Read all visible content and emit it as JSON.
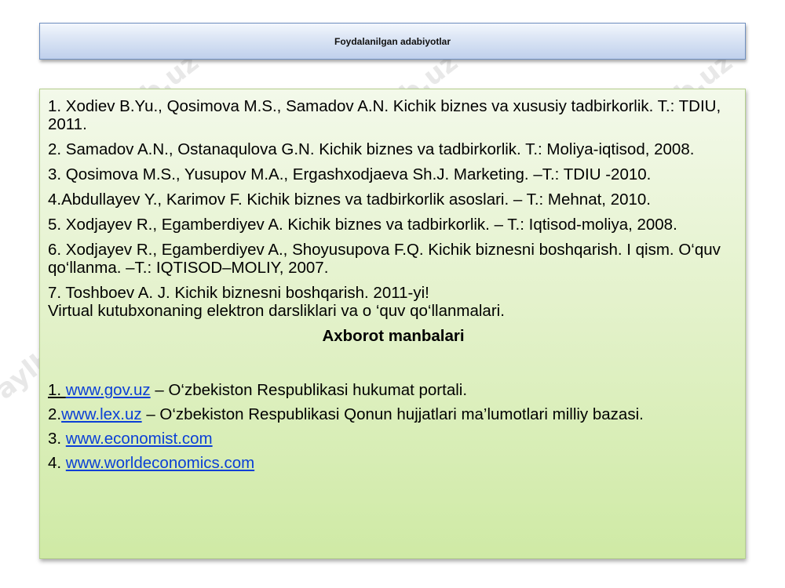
{
  "header": {
    "title": "Foydalanilgan adabiyotlar"
  },
  "references": [
    "1. Xodiev B.Yu., Qosimova M.S., Samadov A.N. Kichik biznes va xususiy tadbirkorlik. T.: TDIU, 2011.",
    "2. Samadov A.N., Ostanaqulova G.N. Kichik biznes va tadbirkorlik. T.: Moliya-iqtisod, 2008.",
    "3. Qosimova M.S., Yusupov M.A., Ergashxodjaeva Sh.J. Marketing. –T.: TDIU -2010.",
    "4.Abdullayev Y., Karimov F. Kichik biznes va tadbirkorlik asoslari. – T.: Mehnat, 2010.",
    "5. Xodjayev R., Egamberdiyev A. Kichik biznes va tadbirkorlik. – T.: Iqtisod-moliya, 2008.",
    "6. Xodjayev R., Egamberdiyev A., Shoyusupova F.Q. Kichik biznesni boshqarish. I qism. O‘quv qo‘llanma. –T.: IQTISOD–MOLIY, 2007.",
    "7. Toshboev A. J. Kichik biznesni boshqarish. 2011-yi!"
  ],
  "references_note": "Virtual kutubxonaning elektron darsliklari va o ‘quv qo‘llanmalari.",
  "sources": {
    "heading": "Axborot manbalari",
    "items": [
      {
        "num": "1. ",
        "link": "www.gov.uz",
        "desc": " – O‘zbekiston Respublikasi hukumat portali."
      },
      {
        "num": "2.",
        "link": "www.lex.uz",
        "desc": " – O‘zbekiston Respublikasi Qonun hujjatlari ma’lumotlari milliy bazasi."
      },
      {
        "num": "3. ",
        "link": "www.economist.com",
        "desc": ""
      },
      {
        "num": "4. ",
        "link": "www.worldeconomics.com",
        "desc": ""
      }
    ]
  },
  "watermark": "Fayllar.uz"
}
